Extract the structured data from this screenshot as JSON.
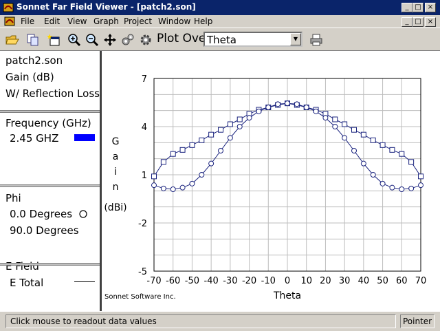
{
  "window": {
    "title": "Sonnet Far Field Viewer - [patch2.son]",
    "controls": [
      "_",
      "□",
      "×"
    ],
    "doc_controls": [
      "_",
      "□",
      "×"
    ]
  },
  "menu": [
    "File",
    "Edit",
    "View",
    "Graph",
    "Project",
    "Window",
    "Help"
  ],
  "toolbar": {
    "icons": [
      "open-folder-icon",
      "copy-icon",
      "new-window-icon",
      "zoom-in-icon",
      "zoom-out-icon",
      "pan-icon",
      "settings-icon",
      "gear-icon"
    ],
    "plot_over_label": "Plot Over",
    "plot_over_value": "Theta",
    "print_icon": "printer-icon"
  },
  "left_panel": {
    "file": "patch2.son",
    "quantity": "Gain (dB)",
    "option": "W/ Reflection Loss",
    "frequency_header": "Frequency (GHz)",
    "frequency_value": "2.45 GHZ",
    "frequency_color": "#0000ff",
    "phi_header": "Phi",
    "phi_items": [
      "0.0 Degrees",
      "90.0 Degrees"
    ],
    "efield_header": "E Field",
    "efield_item": "E Total"
  },
  "chart_data": {
    "type": "line",
    "xlabel": "Theta",
    "ylabel_letters": [
      "G",
      "a",
      "i",
      "n"
    ],
    "ylabel_unit": "(dBi)",
    "xlim": [
      -70,
      70
    ],
    "ylim": [
      -5,
      7
    ],
    "xticks": [
      -70,
      -60,
      -50,
      -40,
      -30,
      -20,
      -10,
      0,
      10,
      20,
      30,
      40,
      50,
      60,
      70
    ],
    "yticks": [
      7,
      4,
      1,
      -2,
      -5
    ],
    "grid": true,
    "credit": "Sonnet Software Inc.",
    "line_color": "#1a237e",
    "series": [
      {
        "name": "0.0 Degrees",
        "marker": "square",
        "x": [
          -70,
          -65,
          -60,
          -55,
          -50,
          -45,
          -40,
          -35,
          -30,
          -25,
          -20,
          -15,
          -10,
          -5,
          0,
          5,
          10,
          15,
          20,
          25,
          30,
          35,
          40,
          45,
          50,
          55,
          60,
          65,
          70
        ],
        "y": [
          0.9,
          1.8,
          2.3,
          2.55,
          2.85,
          3.15,
          3.5,
          3.8,
          4.15,
          4.45,
          4.8,
          5.05,
          5.2,
          5.35,
          5.45,
          5.35,
          5.2,
          5.05,
          4.8,
          4.45,
          4.15,
          3.8,
          3.5,
          3.15,
          2.85,
          2.55,
          2.3,
          1.8,
          0.9
        ]
      },
      {
        "name": "90.0 Degrees",
        "marker": "circle",
        "x": [
          -70,
          -65,
          -60,
          -55,
          -50,
          -45,
          -40,
          -35,
          -30,
          -25,
          -20,
          -15,
          -10,
          -5,
          0,
          5,
          10,
          15,
          20,
          25,
          30,
          35,
          40,
          45,
          50,
          55,
          60,
          65,
          70
        ],
        "y": [
          0.35,
          0.15,
          0.1,
          0.2,
          0.45,
          1.0,
          1.7,
          2.5,
          3.3,
          4.0,
          4.55,
          4.95,
          5.2,
          5.4,
          5.45,
          5.4,
          5.2,
          4.95,
          4.55,
          4.0,
          3.3,
          2.5,
          1.7,
          1.0,
          0.45,
          0.2,
          0.1,
          0.15,
          0.35
        ]
      }
    ]
  },
  "status": {
    "message": "Click mouse to readout data values",
    "mode": "Pointer"
  }
}
